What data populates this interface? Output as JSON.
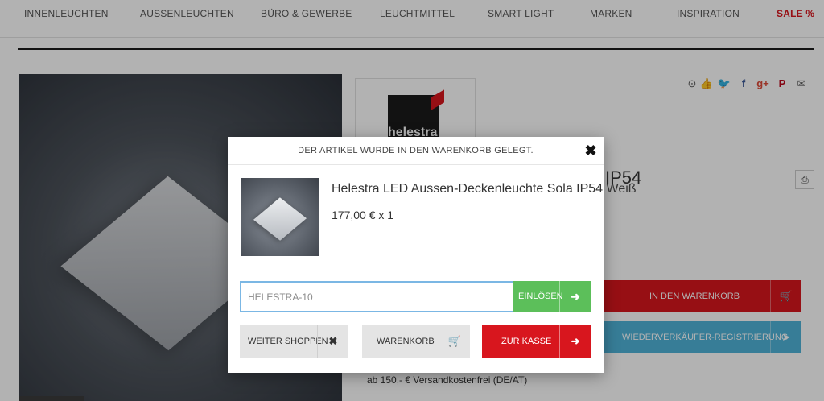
{
  "nav": {
    "items": [
      {
        "label": "INNENLEUCHTEN"
      },
      {
        "label": "AUSSENLEUCHTEN"
      },
      {
        "label": "BÜRO & GEWERBE"
      },
      {
        "label": "LEUCHTMITTEL"
      },
      {
        "label": "SMART LIGHT"
      },
      {
        "label": "MARKEN"
      },
      {
        "label": "INSPIRATION"
      },
      {
        "label": "SALE %"
      }
    ]
  },
  "brand": {
    "logo_text": "helestra"
  },
  "share": {
    "icons": [
      "toggle-icon",
      "thumbs-up-icon",
      "twitter-icon",
      "facebook-icon",
      "google-plus-icon",
      "pinterest-icon",
      "mail-icon"
    ]
  },
  "background_product": {
    "title_fragment": "IP54",
    "cart_button": "IN DEN WARENKORB",
    "reseller_button": "WIEDERVERKÄUFER-REGISTRIERUNG",
    "shipping_note": "ab 150,- € Versandkostenfrei (DE/AT)"
  },
  "modal": {
    "title": "DER ARTIKEL WURDE IN DEN WARENKORB GELEGT.",
    "close_icon": "close-icon",
    "product": {
      "name": "Helestra LED Aussen-Deckenleuchte Sola IP54 Weiß",
      "price": "177,00 € x 1"
    },
    "coupon": {
      "placeholder": "HELESTRA-10",
      "redeem_label": "EINLÖSEN"
    },
    "buttons": {
      "continue": "WEITER SHOPPEN",
      "cart": "WARENKORB",
      "checkout": "ZUR KASSE"
    }
  },
  "colors": {
    "accent_red": "#d8161e",
    "accent_green": "#5cbf5a",
    "accent_blue": "#4fb3d9",
    "input_border": "#7bb7e4"
  }
}
